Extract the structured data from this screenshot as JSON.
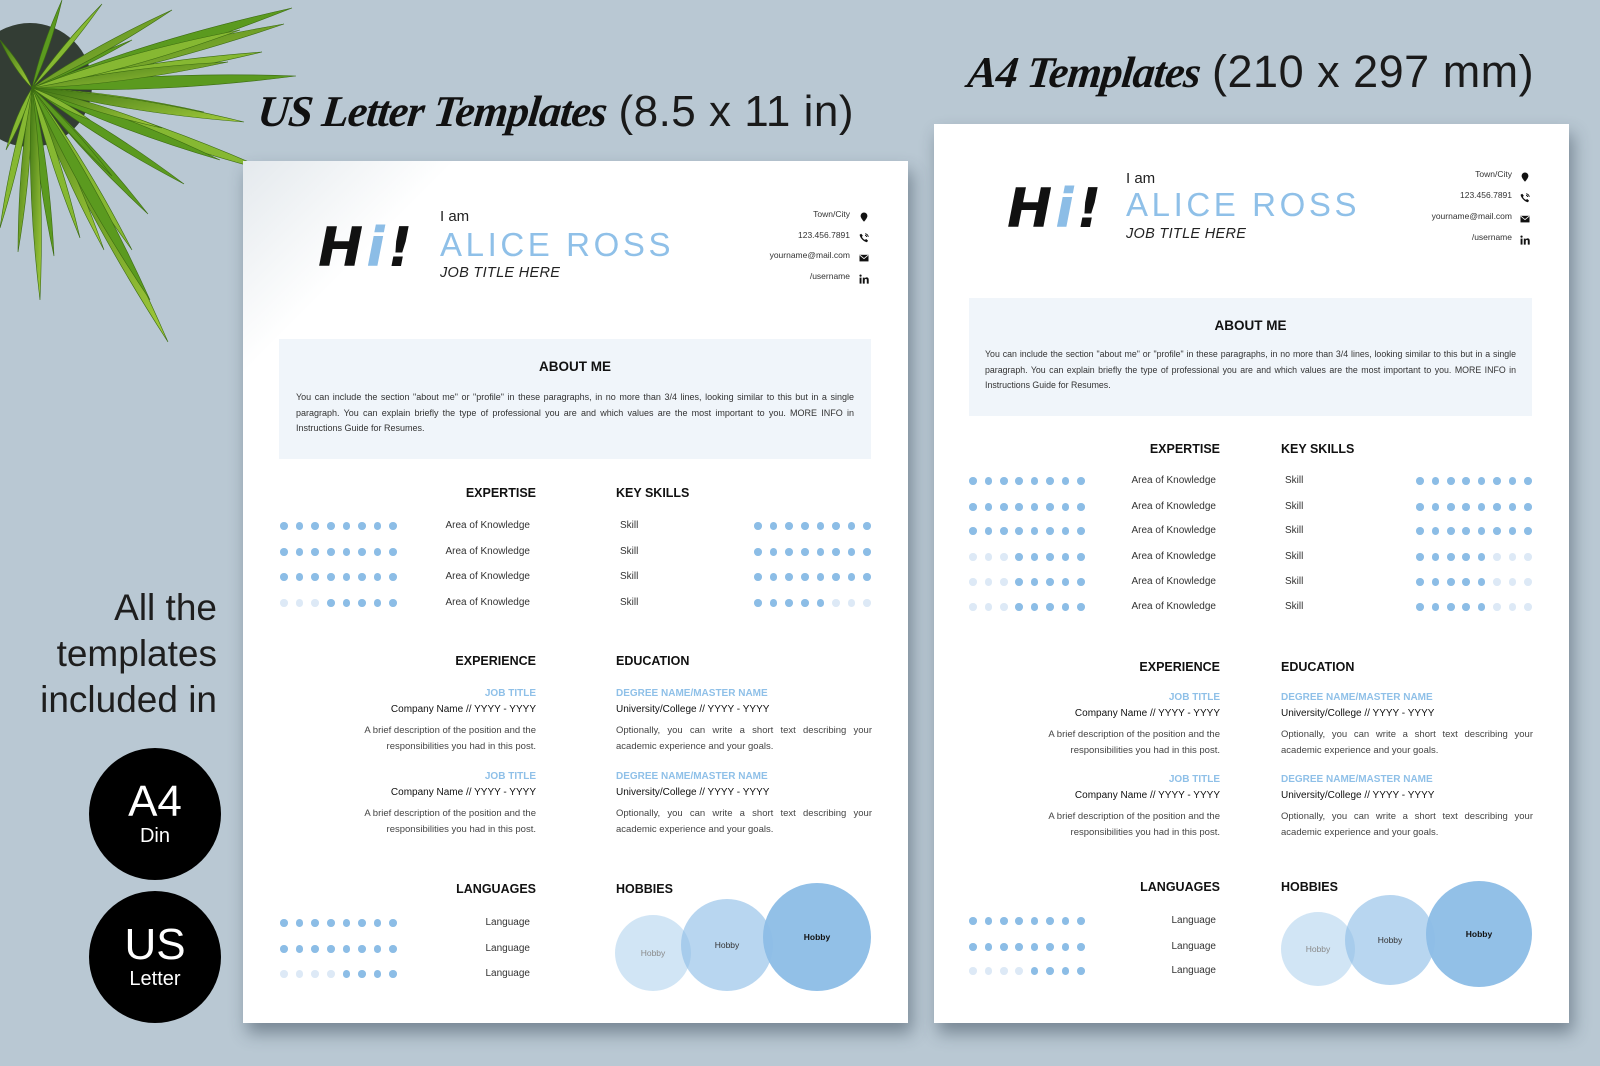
{
  "banner": {
    "us_title_script": "US Letter Templates",
    "us_title_size": "(8.5 x 11 in)",
    "a4_title_script": "A4 Templates",
    "a4_title_size": "(210 x 297 mm)",
    "included_text": [
      "All the",
      "templates",
      "included in"
    ],
    "badges": [
      {
        "main": "A4",
        "sub": "Din"
      },
      {
        "main": "US",
        "sub": "Letter"
      }
    ]
  },
  "colors": {
    "background": "#b9c8d3",
    "accent": "#8cbde6",
    "accent_light": "#dde9f6",
    "about_background": "#f0f5fa",
    "badge": "#000000",
    "text": "#222222"
  },
  "resumes": [
    {
      "format": "US Letter",
      "greeting": [
        "H",
        "i",
        "!"
      ],
      "intro": "I am",
      "name": "ALICE ROSS",
      "job_title": "JOB TITLE HERE",
      "contacts": [
        {
          "icon": "map-pin-icon",
          "text": "Town/City"
        },
        {
          "icon": "phone-icon",
          "text": "123.456.7891"
        },
        {
          "icon": "envelope-icon",
          "text": "yourname@mail.com"
        },
        {
          "icon": "linkedin-icon",
          "text": "/username"
        }
      ],
      "about": {
        "title": "ABOUT ME",
        "text": "You can include the section \"about me\" or \"profile\" in these paragraphs, in no more than 3/4 lines, looking similar to this but in a single paragraph. You can explain briefly the type of professional you are and which values are the most important to you. MORE INFO in Instructions Guide for Resumes."
      },
      "expertise": {
        "title": "EXPERTISE",
        "max": 8,
        "items": [
          {
            "label": "Area of Knowledge",
            "level": 8
          },
          {
            "label": "Area of Knowledge",
            "level": 8
          },
          {
            "label": "Area of Knowledge",
            "level": 8
          },
          {
            "label": "Area of Knowledge",
            "level": 5
          }
        ]
      },
      "key_skills": {
        "title": "KEY SKILLS",
        "max": 8,
        "items": [
          {
            "label": "Skill",
            "level": 8
          },
          {
            "label": "Skill",
            "level": 8
          },
          {
            "label": "Skill",
            "level": 8
          },
          {
            "label": "Skill",
            "level": 5
          }
        ]
      },
      "experience": {
        "title": "EXPERIENCE",
        "entries": [
          {
            "title": "JOB TITLE",
            "company": "Company Name // YYYY - YYYY",
            "description": "A brief description of the position and the responsibilities you had in this post."
          },
          {
            "title": "JOB TITLE",
            "company": "Company Name // YYYY - YYYY",
            "description": "A brief description of the position and the responsibilities you had in this post."
          }
        ]
      },
      "education": {
        "title": "EDUCATION",
        "entries": [
          {
            "degree": "DEGREE NAME/MASTER NAME",
            "school": "University/College // YYYY - YYYY",
            "description": "Optionally, you can write a short text describing your academic experience and your goals."
          },
          {
            "degree": "DEGREE NAME/MASTER NAME",
            "school": "University/College // YYYY - YYYY",
            "description": "Optionally, you can write a short text describing your academic experience and your goals."
          }
        ]
      },
      "languages": {
        "title": "LANGUAGES",
        "max": 8,
        "items": [
          {
            "label": "Language",
            "level": 8
          },
          {
            "label": "Language",
            "level": 8
          },
          {
            "label": "Language",
            "level": 4
          }
        ]
      },
      "hobbies": {
        "title": "HOBBIES",
        "items": [
          "Hobby",
          "Hobby",
          "Hobby"
        ]
      }
    },
    {
      "format": "A4",
      "greeting": [
        "H",
        "i",
        "!"
      ],
      "intro": "I am",
      "name": "ALICE ROSS",
      "job_title": "JOB TITLE HERE",
      "contacts": [
        {
          "icon": "map-pin-icon",
          "text": "Town/City"
        },
        {
          "icon": "phone-icon",
          "text": "123.456.7891"
        },
        {
          "icon": "envelope-icon",
          "text": "yourname@mail.com"
        },
        {
          "icon": "linkedin-icon",
          "text": "/username"
        }
      ],
      "about": {
        "title": "ABOUT ME",
        "text": "You can include the section \"about me\" or \"profile\" in these paragraphs, in no more than 3/4 lines, looking similar to this but in a single paragraph. You can explain briefly the type of professional you are and which values are the most important to you. MORE INFO in Instructions Guide for Resumes."
      },
      "expertise": {
        "title": "EXPERTISE",
        "max": 8,
        "items": [
          {
            "label": "Area of Knowledge",
            "level": 8
          },
          {
            "label": "Area of Knowledge",
            "level": 8
          },
          {
            "label": "Area of Knowledge",
            "level": 8
          },
          {
            "label": "Area of Knowledge",
            "level": 5
          },
          {
            "label": "Area of Knowledge",
            "level": 5
          },
          {
            "label": "Area of Knowledge",
            "level": 5
          }
        ]
      },
      "key_skills": {
        "title": "KEY SKILLS",
        "max": 8,
        "items": [
          {
            "label": "Skill",
            "level": 8
          },
          {
            "label": "Skill",
            "level": 8
          },
          {
            "label": "Skill",
            "level": 8
          },
          {
            "label": "Skill",
            "level": 5
          },
          {
            "label": "Skill",
            "level": 5
          },
          {
            "label": "Skill",
            "level": 5
          }
        ]
      },
      "experience": {
        "title": "EXPERIENCE",
        "entries": [
          {
            "title": "JOB TITLE",
            "company": "Company Name // YYYY - YYYY",
            "description": "A brief description of the position and the responsibilities you had in this post."
          },
          {
            "title": "JOB TITLE",
            "company": "Company Name // YYYY - YYYY",
            "description": "A brief description of the position and the responsibilities you had in this post."
          }
        ]
      },
      "education": {
        "title": "EDUCATION",
        "entries": [
          {
            "degree": "DEGREE NAME/MASTER NAME",
            "school": "University/College // YYYY - YYYY",
            "description": "Optionally, you can write a short text describing your academic experience and your goals."
          },
          {
            "degree": "DEGREE NAME/MASTER NAME",
            "school": "University/College // YYYY - YYYY",
            "description": "Optionally, you can write a short text describing your academic experience and your goals."
          }
        ]
      },
      "languages": {
        "title": "LANGUAGES",
        "max": 8,
        "items": [
          {
            "label": "Language",
            "level": 8
          },
          {
            "label": "Language",
            "level": 8
          },
          {
            "label": "Language",
            "level": 4
          }
        ]
      },
      "hobbies": {
        "title": "HOBBIES",
        "items": [
          "Hobby",
          "Hobby",
          "Hobby"
        ]
      }
    }
  ]
}
